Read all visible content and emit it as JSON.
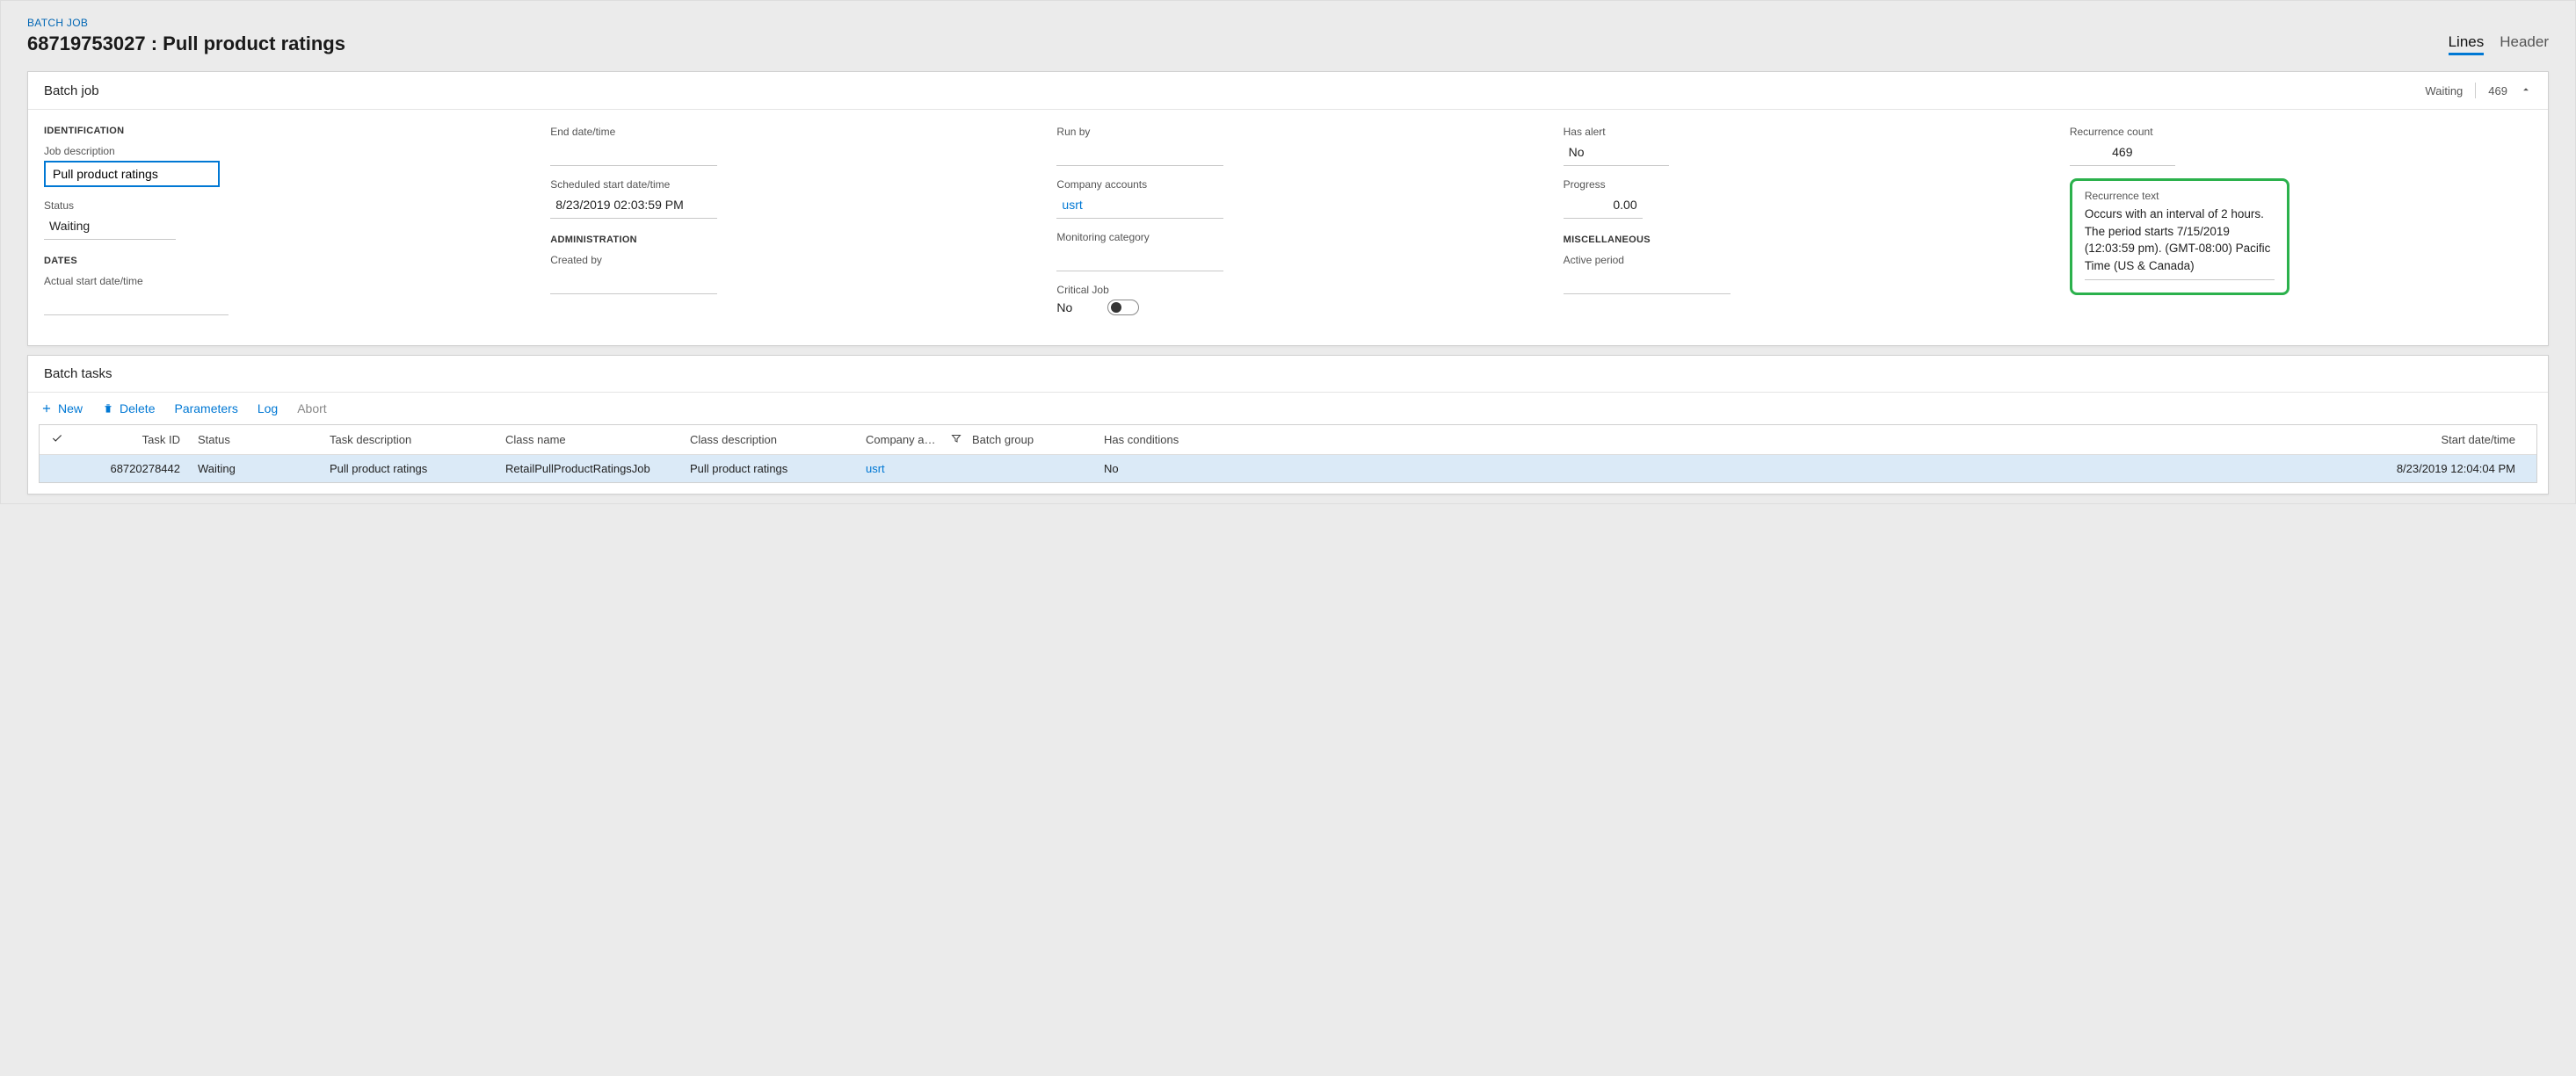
{
  "breadcrumb": "BATCH JOB",
  "page_title": "68719753027 : Pull product ratings",
  "view_tabs": {
    "lines": "Lines",
    "header": "Header",
    "active": "lines"
  },
  "card_batchjob": {
    "title": "Batch job",
    "status_header": "Waiting",
    "count_header": "469"
  },
  "sections": {
    "identification": "IDENTIFICATION",
    "dates": "DATES",
    "administration": "ADMINISTRATION",
    "miscellaneous": "MISCELLANEOUS"
  },
  "fields": {
    "job_description_label": "Job description",
    "job_description_value": "Pull product ratings",
    "status_label": "Status",
    "status_value": "Waiting",
    "actual_start_label": "Actual start date/time",
    "actual_start_value": "",
    "end_date_label": "End date/time",
    "end_date_value": "",
    "scheduled_start_label": "Scheduled start date/time",
    "scheduled_start_value": "8/23/2019 02:03:59 PM",
    "created_by_label": "Created by",
    "created_by_value": "",
    "run_by_label": "Run by",
    "run_by_value": "",
    "company_accounts_label": "Company accounts",
    "company_accounts_value": "usrt",
    "monitoring_category_label": "Monitoring category",
    "monitoring_category_value": "",
    "critical_job_label": "Critical Job",
    "critical_job_no": "No",
    "has_alert_label": "Has alert",
    "has_alert_value": "No",
    "progress_label": "Progress",
    "progress_value": "0.00",
    "active_period_label": "Active period",
    "active_period_value": "",
    "recurrence_count_label": "Recurrence count",
    "recurrence_count_value": "469",
    "recurrence_text_label": "Recurrence text",
    "recurrence_text_value": "Occurs with an interval of 2 hours. The period starts 7/15/2019 (12:03:59 pm). (GMT-08:00) Pacific Time (US & Canada)"
  },
  "batch_tasks": {
    "title": "Batch tasks",
    "toolbar": {
      "new": "New",
      "delete": "Delete",
      "parameters": "Parameters",
      "log": "Log",
      "abort": "Abort"
    },
    "columns": {
      "task_id": "Task ID",
      "status": "Status",
      "task_description": "Task description",
      "class_name": "Class name",
      "class_description": "Class description",
      "company_acc": "Company acc...",
      "batch_group": "Batch group",
      "has_conditions": "Has conditions",
      "start_datetime": "Start date/time"
    },
    "rows": [
      {
        "task_id": "68720278442",
        "status": "Waiting",
        "task_description": "Pull product ratings",
        "class_name": "RetailPullProductRatingsJob",
        "class_description": "Pull product ratings",
        "company_acc": "usrt",
        "batch_group": "",
        "has_conditions": "No",
        "start_datetime": "8/23/2019 12:04:04 PM"
      }
    ]
  }
}
